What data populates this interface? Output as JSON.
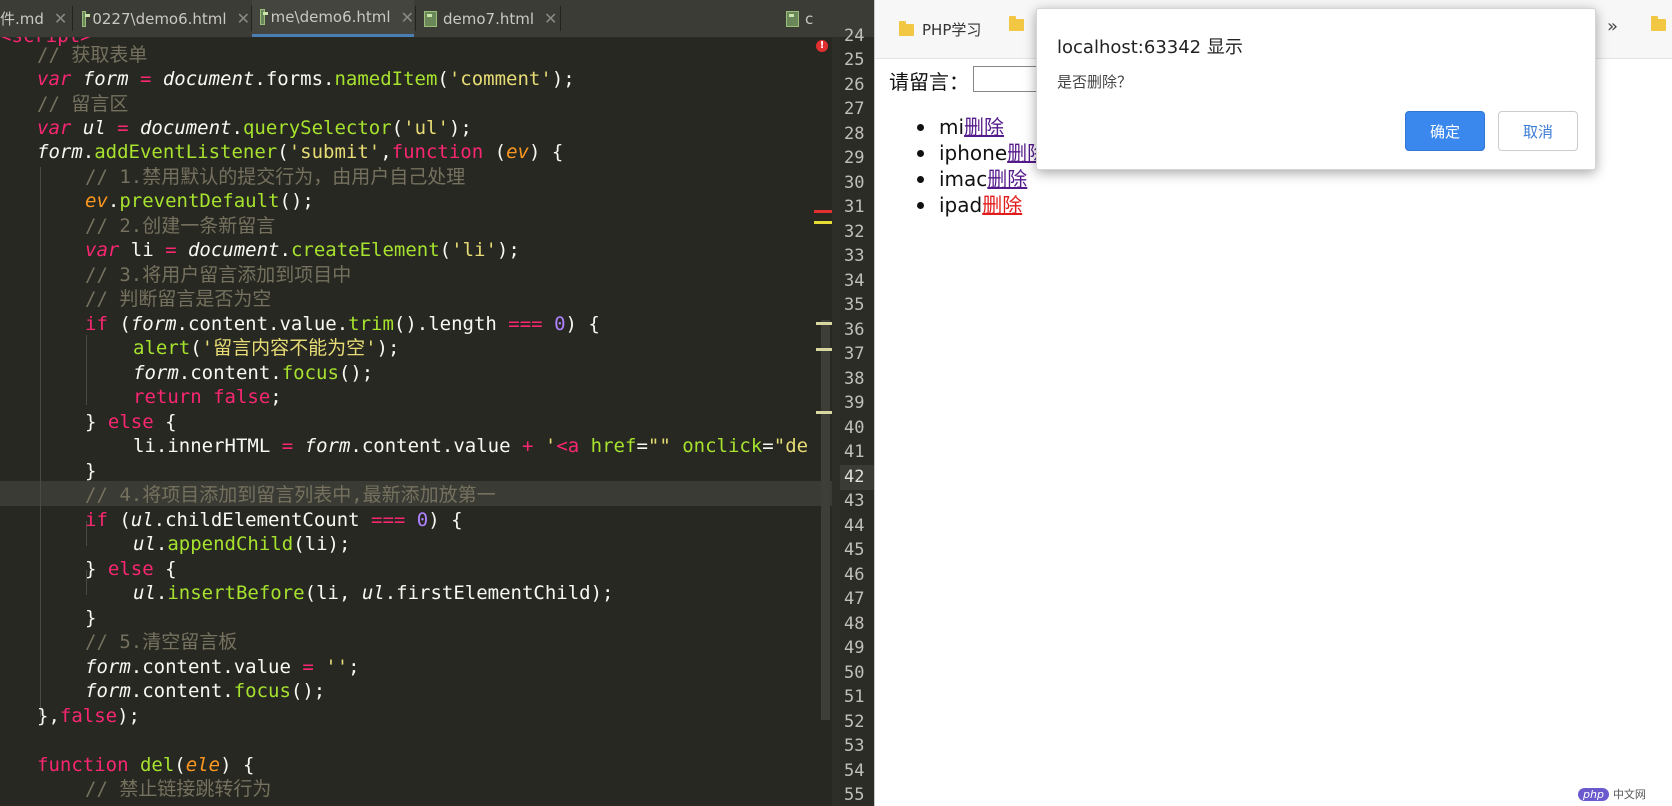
{
  "editor": {
    "tabs": [
      {
        "label": "件.md",
        "icon": "markdown-file-icon"
      },
      {
        "label": "0227\\demo6.html",
        "icon": "html-file-icon"
      },
      {
        "label": "me\\demo6.html",
        "icon": "html-file-icon",
        "active": true
      },
      {
        "label": "demo7.html",
        "icon": "html-file-icon"
      }
    ],
    "tab_overflow_label": "c",
    "line_numbers": [
      "24",
      "25",
      "26",
      "27",
      "28",
      "29",
      "30",
      "31",
      "32",
      "33",
      "34",
      "35",
      "36",
      "37",
      "38",
      "39",
      "40",
      "41",
      "42",
      "43",
      "44",
      "45",
      "46",
      "47",
      "48",
      "49",
      "50",
      "51",
      "52",
      "53",
      "54",
      "55"
    ],
    "current_line": "42",
    "code": {
      "l24": "<script>",
      "l25": "// 获取表单",
      "l26_var": "var ",
      "l26_name": "form",
      "l26_eq": " = ",
      "l26_obj": "document",
      "l26_a": ".forms.",
      "l26_fn": "namedItem",
      "l26_b": "(",
      "l26_str": "'comment'",
      "l26_c": ");",
      "l27": "// 留言区",
      "l28_var": "var ",
      "l28_name": "ul",
      "l28_eq": " = ",
      "l28_obj": "document",
      "l28_a": ".",
      "l28_fn": "querySelector",
      "l28_b": "(",
      "l28_str": "'ul'",
      "l28_c": ");",
      "l29_obj": "form",
      "l29_a": ".",
      "l29_fn": "addEventListener",
      "l29_b": "(",
      "l29_str": "'submit'",
      "l29_c": ",",
      "l29_kw": "function",
      "l29_d": " (",
      "l29_p": "ev",
      "l29_e": ") {",
      "l30": "// 1.禁用默认的提交行为，由用户自己处理",
      "l31_p": "ev",
      "l31_a": ".",
      "l31_fn": "preventDefault",
      "l31_b": "();",
      "l32": "// 2.创建一条新留言",
      "l33_var": "var ",
      "l33_name": "li",
      "l33_eq": " = ",
      "l33_obj": "document",
      "l33_a": ".",
      "l33_fn": "createElement",
      "l33_b": "(",
      "l33_str": "'li'",
      "l33_c": ");",
      "l34": "// 3.将用户留言添加到项目中",
      "l35": "// 判断留言是否为空",
      "l36_kw": "if",
      "l36_a": " (",
      "l36_obj": "form",
      "l36_b": ".content.value.",
      "l36_fn": "trim",
      "l36_c": "().length ",
      "l36_op": "===",
      "l36_d": " ",
      "l36_num": "0",
      "l36_e": ") {",
      "l37_fn": "alert",
      "l37_a": "(",
      "l37_str": "'留言内容不能为空'",
      "l37_b": ");",
      "l38_obj": "form",
      "l38_a": ".content.",
      "l38_fn": "focus",
      "l38_b": "();",
      "l39_kw": "return ",
      "l39_kw2": "false",
      "l39_a": ";",
      "l40_a": "} ",
      "l40_kw": "else",
      "l40_b": " {",
      "l41_a": "li.innerHTML ",
      "l41_op": "=",
      "l41_b": " ",
      "l41_obj": "form",
      "l41_c": ".content.value ",
      "l41_op2": "+",
      "l41_d": " ",
      "l41_q": "'",
      "l41_tag": "<a",
      "l41_attr": " href",
      "l41_e": "=",
      "l41_str": "\"\"",
      "l41_attr2": " onclick",
      "l41_f": "=",
      "l41_str2": "\"de",
      "l42": "}",
      "l43": "// 4.将项目添加到留言列表中,最新添加放第一",
      "l44_kw": "if",
      "l44_a": " (",
      "l44_obj": "ul",
      "l44_b": ".childElementCount ",
      "l44_op": "===",
      "l44_c": " ",
      "l44_num": "0",
      "l44_d": ") {",
      "l45_obj": "ul",
      "l45_a": ".",
      "l45_fn": "appendChild",
      "l45_b": "(li);",
      "l46_a": "} ",
      "l46_kw": "else",
      "l46_b": " {",
      "l47_obj": "ul",
      "l47_a": ".",
      "l47_fn": "insertBefore",
      "l47_b": "(li, ",
      "l47_obj2": "ul",
      "l47_c": ".firstElementChild);",
      "l48": "}",
      "l49": "// 5.清空留言板",
      "l50_obj": "form",
      "l50_a": ".content.value ",
      "l50_op": "=",
      "l50_b": " ",
      "l50_str": "''",
      "l50_c": ";",
      "l51_obj": "form",
      "l51_a": ".content.",
      "l51_fn": "focus",
      "l51_b": "();",
      "l52_a": "},",
      "l52_kw": "false",
      "l52_b": ");",
      "l54_kw": "function ",
      "l54_fn": "del",
      "l54_a": "(",
      "l54_p": "ele",
      "l54_b": ") {",
      "l55": "// 禁止链接跳转行为"
    },
    "colors": {
      "background": "#272822",
      "comment": "#75715e",
      "keyword": "#f92672",
      "function": "#a6e22e",
      "string": "#e6db74",
      "number": "#ae81ff",
      "param": "#fd971f"
    }
  },
  "browser": {
    "bookmarks": [
      {
        "label": "PHP学习",
        "icon": "folder-icon"
      },
      {
        "label": "",
        "icon": "folder-icon"
      }
    ],
    "overflow_label": "»",
    "form_label": "请留言：",
    "items": [
      {
        "text": "mi",
        "link": "删除",
        "visited": true
      },
      {
        "text": "iphone",
        "link": "删除",
        "visited": true
      },
      {
        "text": "imac",
        "link": "删除",
        "visited": true
      },
      {
        "text": "ipad",
        "link": "删除",
        "visited": false
      }
    ],
    "link_colors": {
      "visited": "#551a8b",
      "active": "#e21b1b"
    }
  },
  "dialog": {
    "title": "localhost:63342 显示",
    "message": "是否删除？",
    "ok_label": "确定",
    "cancel_label": "取消",
    "accent": "#3a88ee"
  },
  "watermark": {
    "logo": "php",
    "text": "中文网"
  }
}
